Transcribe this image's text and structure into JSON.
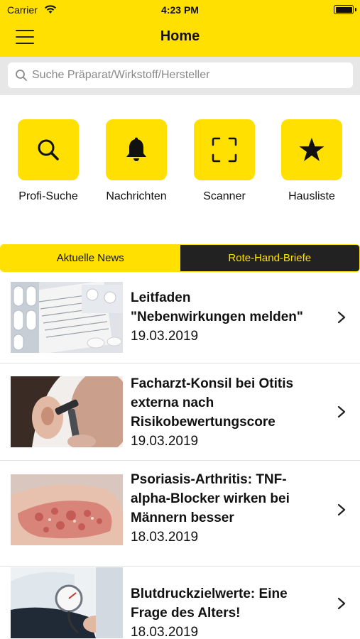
{
  "status_bar": {
    "carrier": "Carrier",
    "time": "4:23 PM"
  },
  "nav": {
    "title": "Home"
  },
  "search": {
    "placeholder": "Suche Präparat/Wirkstoff/Hersteller"
  },
  "actions": [
    {
      "label": "Profi-Suche",
      "icon": "search-icon"
    },
    {
      "label": "Nachrichten",
      "icon": "bell-icon"
    },
    {
      "label": "Scanner",
      "icon": "scan-frame-icon"
    },
    {
      "label": "Hausliste",
      "icon": "star-icon"
    }
  ],
  "tabs": [
    {
      "label": "Aktuelle News",
      "active": true
    },
    {
      "label": "Rote-Hand-Briefe",
      "active": false
    }
  ],
  "news": [
    {
      "title_lines": [
        "Leitfaden",
        "\"Nebenwirkungen melden\""
      ],
      "date": "19.03.2019",
      "thumb": "pills-leaflet-photo"
    },
    {
      "title_lines": [
        "Facharzt-Konsil bei Otitis",
        "externa nach",
        "Risikobewertungscore"
      ],
      "date": "19.03.2019",
      "thumb": "ear-exam-photo"
    },
    {
      "title_lines": [
        "Psoriasis-Arthritis: TNF-",
        "alpha-Blocker wirken bei",
        "Männern besser"
      ],
      "date": "18.03.2019",
      "thumb": "psoriasis-elbow-photo"
    },
    {
      "title_lines": [
        "Blutdruckzielwerte: Eine",
        "Frage des Alters!"
      ],
      "date": "18.03.2019",
      "thumb": "blood-pressure-photo"
    }
  ],
  "colors": {
    "accent": "#ffe000",
    "dark": "#222222",
    "separator": "#e3e3e3",
    "search_bg": "#e7e7e7"
  }
}
